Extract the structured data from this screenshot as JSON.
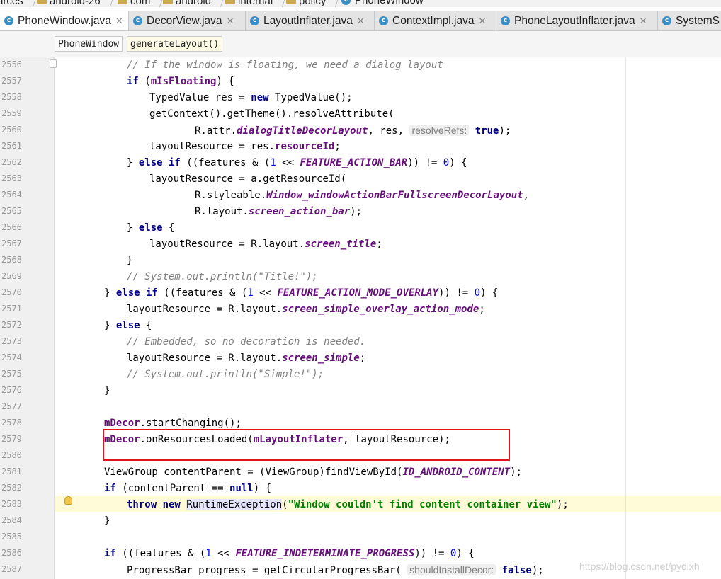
{
  "breadcrumb": [
    "urces",
    "android-26",
    "com",
    "android",
    "internal",
    "policy",
    "PhoneWindow"
  ],
  "tabs": [
    {
      "label": "PhoneWindow.java",
      "active": true
    },
    {
      "label": "DecorView.java",
      "active": false
    },
    {
      "label": "LayoutInflater.java",
      "active": false
    },
    {
      "label": "ContextImpl.java",
      "active": false
    },
    {
      "label": "PhoneLayoutInflater.java",
      "active": false
    },
    {
      "label": "SystemS",
      "active": false
    }
  ],
  "structure": {
    "class": "PhoneWindow",
    "method": "generateLayout()"
  },
  "line_numbers": [
    "2556",
    "2557",
    "2558",
    "2559",
    "2560",
    "2561",
    "2562",
    "2563",
    "2564",
    "2565",
    "2566",
    "2567",
    "2568",
    "2569",
    "2570",
    "2571",
    "2572",
    "2573",
    "2574",
    "2575",
    "2576",
    "2577",
    "2578",
    "2579",
    "2580",
    "2581",
    "2582",
    "2583",
    "2584",
    "2585",
    "2586",
    "2587"
  ],
  "code": {
    "l2556": "// If the window is floating, we need a dialog layout",
    "l2557": {
      "kw": "if",
      "a": " (",
      "fld": "mIsFloating",
      "b": ") {"
    },
    "l2558": {
      "a": "TypedValue res = ",
      "kw": "new",
      "b": " TypedValue();"
    },
    "l2559": "getContext().getTheme().resolveAttribute(",
    "l2560": {
      "a": "R.attr.",
      "st": "dialogTitleDecorLayout",
      "b": ", res,",
      "hint": "resolveRefs:",
      "kw": "true",
      "c": ");"
    },
    "l2561": {
      "a": "layoutResource = res.",
      "fld": "resourceId",
      "b": ";"
    },
    "l2562": {
      "a": "} ",
      "kw": "else if",
      "b": " ((features & (",
      "n1": "1",
      "c": " << ",
      "st": "FEATURE_ACTION_BAR",
      "d": ")) != ",
      "n2": "0",
      "e": ") {"
    },
    "l2563": "layoutResource = a.getResourceId(",
    "l2564": {
      "a": "R.styleable.",
      "st": "Window_windowActionBarFullscreenDecorLayout",
      "b": ","
    },
    "l2565": {
      "a": "R.layout.",
      "st": "screen_action_bar",
      "b": ");"
    },
    "l2566": {
      "a": "} ",
      "kw": "else",
      "b": " {"
    },
    "l2567": {
      "a": "layoutResource = R.layout.",
      "st": "screen_title",
      "b": ";"
    },
    "l2568": "}",
    "l2569": "// System.out.println(\"Title!\");",
    "l2570": {
      "a": "} ",
      "kw": "else if",
      "b": " ((features & (",
      "n1": "1",
      "c": " << ",
      "st": "FEATURE_ACTION_MODE_OVERLAY",
      "d": ")) != ",
      "n2": "0",
      "e": ") {"
    },
    "l2571": {
      "a": "layoutResource = R.layout.",
      "st": "screen_simple_overlay_action_mode",
      "b": ";"
    },
    "l2572": {
      "a": "} ",
      "kw": "else",
      "b": " {"
    },
    "l2573": "// Embedded, so no decoration is needed.",
    "l2574": {
      "a": "layoutResource = R.layout.",
      "st": "screen_simple",
      "b": ";"
    },
    "l2575": "// System.out.println(\"Simple!\");",
    "l2576": "}",
    "l2578": {
      "fld": "mDecor",
      "a": ".startChanging();"
    },
    "l2579": {
      "fld": "mDecor",
      "a": ".onResourcesLoaded(",
      "fld2": "mLayoutInflater",
      "b": ", layoutResource);"
    },
    "l2581": {
      "a": "ViewGroup contentParent = (ViewGroup)findViewById(",
      "st": "ID_ANDROID_CONTENT",
      "b": ");"
    },
    "l2582": {
      "kw": "if",
      "a": " (contentParent == ",
      "kw2": "null",
      "b": ") {"
    },
    "l2583": {
      "kw": "throw new",
      "a": " ",
      "call": "RuntimeException",
      "b": "(",
      "str": "\"Window couldn't find content container view\"",
      "c": ");"
    },
    "l2584": "}",
    "l2586": {
      "kw": "if",
      "a": " ((features & (",
      "n1": "1",
      "c": " << ",
      "st": "FEATURE_INDETERMINATE_PROGRESS",
      "d": ")) != ",
      "n2": "0",
      "e": ") {"
    },
    "l2587": {
      "a": "ProgressBar progress = getCircularProgressBar(",
      "hint": "shouldInstallDecor:",
      "kw": "false",
      "b": ");"
    }
  },
  "watermark": "https://blog.csdn.net/pydlxh",
  "colors": {
    "keyword": "#000080",
    "field": "#660e7a",
    "comment": "#808080",
    "number": "#0000ff",
    "string": "#008000",
    "highlight_box": "#e0151c"
  }
}
